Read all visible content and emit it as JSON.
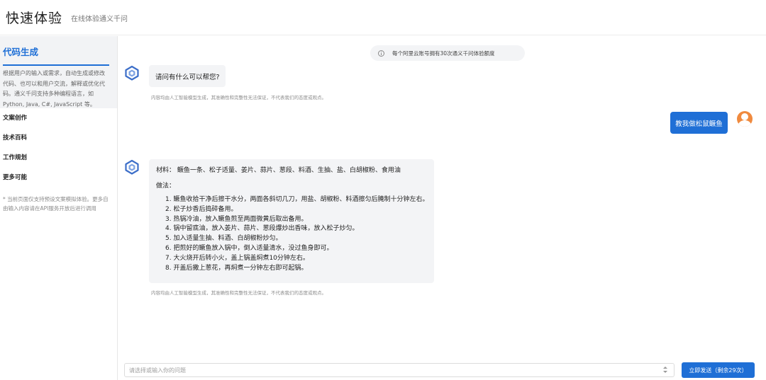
{
  "header": {
    "title": "快速体验",
    "subtitle": "在线体验通义千问"
  },
  "sidebar": {
    "active": {
      "label": "代码生成",
      "description": "根据用户的输入或需求，自动生成或修改代码、也可以和用户交流，解释或优化代码。通义千问支持多种编程语言，如Python, Java, C#, JavaScript 等。"
    },
    "items": [
      {
        "label": "文案创作"
      },
      {
        "label": "技术百科"
      },
      {
        "label": "工作规划"
      },
      {
        "label": "更多可能"
      }
    ],
    "note": "* 当前页面仅支持预设文案模拟体验。更多自由输入内容请在API服务开放后进行调用"
  },
  "notice": {
    "icon": "info-icon",
    "text": "每个阿里云账号拥有30次通义千问体验额度"
  },
  "chat": {
    "greeting": "请问有什么可以帮您?",
    "disclaimer": "内容均由人工智能模型生成，其准确性和完整性无法保证，不代表我们的态度或观点。",
    "user_message": "教我做松鼠鳜鱼",
    "recipe": {
      "ingredients": "材料：  鳜鱼一条、松子适量、姜片、蒜片、葱段、料酒、生抽、盐、白胡椒粉、食用油",
      "method_label": "做法：",
      "steps": [
        "1. 鳜鱼收拾干净后擦干水分，两面各斜切几刀，用盐、胡椒粉、料酒擦匀后腌制十分钟左右。",
        "2. 松子炒香后捣碎备用。",
        "3. 热锅冷油，放入鳜鱼煎至两面微黄后取出备用。",
        "4. 锅中留底油，放入姜片、蒜片、葱段爆炒出香味，放入松子炒匀。",
        "5. 加入适量生抽、料酒、白胡椒粉炒匀。",
        "6. 把煎好的鳜鱼放入锅中，倒入适量清水，没过鱼身即可。",
        "7. 大火烧开后转小火，盖上锅盖焖煮10分钟左右。",
        "8. 开盖后撒上葱花，再焖煮一分钟左右即可起锅。"
      ]
    }
  },
  "composer": {
    "placeholder": "请选择或输入你的问题",
    "send_label": "立即发送（剩余29次）"
  },
  "colors": {
    "accent": "#1f6fd6",
    "bot_bubble": "#f3f4f6",
    "user_avatar": "#f08a3e"
  }
}
